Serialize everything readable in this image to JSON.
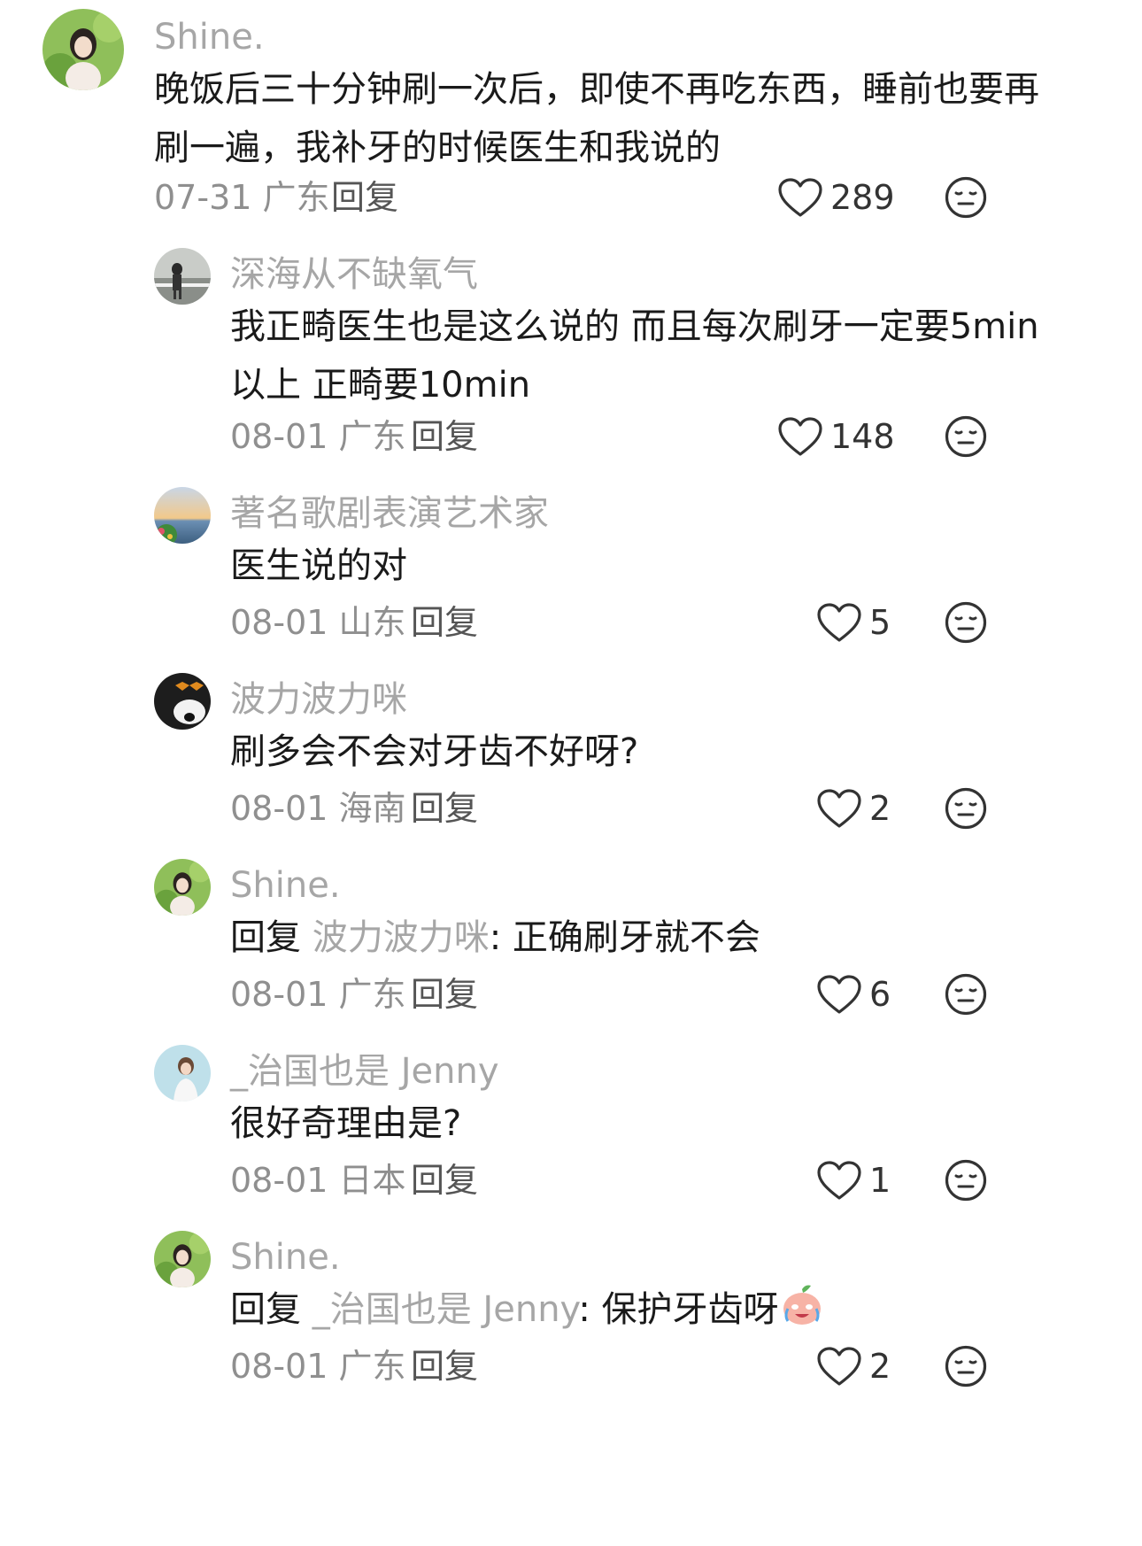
{
  "comments": [
    {
      "id": "c1",
      "author": "Shine.",
      "text_line1": "晚饭后三十分钟刷一次后，即使不再吃东西，睡前也要再",
      "text_line2": "刷一遍，我补牙的时候医生和我说的",
      "date": "07-31",
      "region": "广东",
      "reply_label": "回复",
      "likes": "289"
    },
    {
      "id": "c2",
      "author": "深海从不缺氧气",
      "text_line1": "我正畸医生也是这么说的 而且每次刷牙一定要5min",
      "text_line2": "以上 正畸要10min",
      "date": "08-01",
      "region": "广东",
      "reply_label": "回复",
      "likes": "148"
    },
    {
      "id": "c3",
      "author": "著名歌剧表演艺术家",
      "text_line1": "医生说的对",
      "date": "08-01",
      "region": "山东",
      "reply_label": "回复",
      "likes": "5"
    },
    {
      "id": "c4",
      "author": "波力波力咪",
      "text_line1": "刷多会不会对牙齿不好呀?",
      "date": "08-01",
      "region": "海南",
      "reply_label": "回复",
      "likes": "2"
    },
    {
      "id": "c5",
      "author": "Shine.",
      "reply_prefix": "回复",
      "reply_to": "波力波力咪",
      "text_line1": ": 正确刷牙就不会",
      "date": "08-01",
      "region": "广东",
      "reply_label": "回复",
      "likes": "6"
    },
    {
      "id": "c6",
      "author": "_治国也是 Jenny",
      "text_line1": "很好奇理由是?",
      "date": "08-01",
      "region": "日本",
      "reply_label": "回复",
      "likes": "1"
    },
    {
      "id": "c7",
      "author": "Shine.",
      "reply_prefix": "回复",
      "reply_to": "_治国也是 Jenny",
      "text_line1": ": 保护牙齿呀",
      "date": "08-01",
      "region": "广东",
      "reply_label": "回复",
      "likes": "2"
    }
  ],
  "icons": {
    "like": "heart-outline-icon",
    "dislike": "neutral-face-icon",
    "emoji": "crying-peach-emoji"
  },
  "colors": {
    "username": "#a6a6a6",
    "text": "#1a1a1a",
    "meta": "#8f8f8f"
  }
}
